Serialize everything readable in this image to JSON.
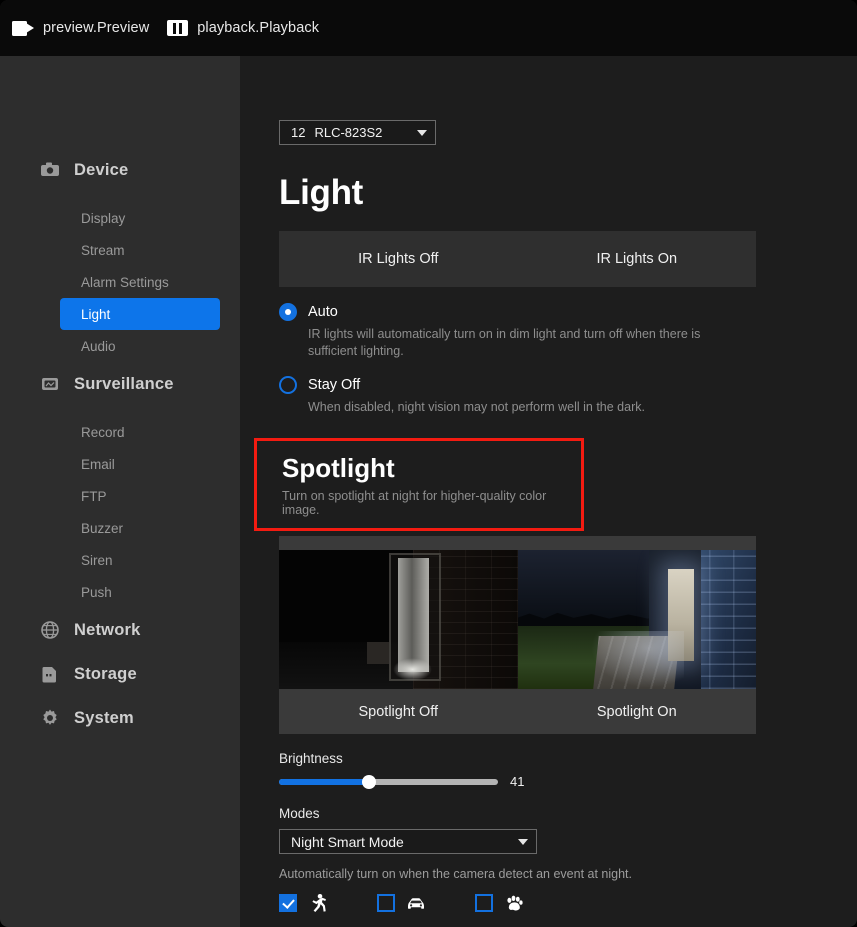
{
  "topbar": {
    "tabs": [
      {
        "icon": "video-camera-icon",
        "label": "preview.Preview"
      },
      {
        "icon": "film-strip-icon",
        "label": "playback.Playback"
      }
    ]
  },
  "sidebar": {
    "groups": [
      {
        "label": "Device",
        "icon": "camera-icon",
        "items": [
          {
            "label": "Display",
            "active": false
          },
          {
            "label": "Stream",
            "active": false
          },
          {
            "label": "Alarm Settings",
            "active": false
          },
          {
            "label": "Light",
            "active": true
          },
          {
            "label": "Audio",
            "active": false
          }
        ]
      },
      {
        "label": "Surveillance",
        "icon": "monitor-icon",
        "items": [
          {
            "label": "Record",
            "active": false
          },
          {
            "label": "Email",
            "active": false
          },
          {
            "label": "FTP",
            "active": false
          },
          {
            "label": "Buzzer",
            "active": false
          },
          {
            "label": "Siren",
            "active": false
          },
          {
            "label": "Push",
            "active": false
          }
        ]
      },
      {
        "label": "Network",
        "icon": "globe-icon",
        "items": []
      },
      {
        "label": "Storage",
        "icon": "sd-card-icon",
        "items": []
      },
      {
        "label": "System",
        "icon": "gear-icon",
        "items": []
      }
    ]
  },
  "main": {
    "camera_select": {
      "channel": "12",
      "model": "RLC-823S2",
      "icon": "chevron-down-icon"
    },
    "page_title": "Light",
    "ir": {
      "compare_left": "IR Lights Off",
      "compare_right": "IR Lights On",
      "options": [
        {
          "label": "Auto",
          "selected": true,
          "description": "IR lights will automatically turn on in dim light and turn off when there is sufficient lighting."
        },
        {
          "label": "Stay Off",
          "selected": false,
          "description": "When disabled, night vision may not perform well in the dark."
        }
      ]
    },
    "spotlight": {
      "title": "Spotlight",
      "description": "Turn on spotlight at night for higher-quality color image.",
      "highlight_color": "#f31b11",
      "compare_left": "Spotlight Off",
      "compare_right": "Spotlight On",
      "brightness_label": "Brightness",
      "brightness_value": "41",
      "brightness_percent": 41,
      "modes_label": "Modes",
      "mode_selected": "Night Smart Mode",
      "mode_icon": "chevron-down-icon",
      "detect_description": "Automatically turn on when the camera detect an event at night.",
      "detect_options": [
        {
          "name": "person",
          "icon": "person-running-icon",
          "checked": true
        },
        {
          "name": "vehicle",
          "icon": "car-icon",
          "checked": false
        },
        {
          "name": "pet",
          "icon": "paw-print-icon",
          "checked": false
        }
      ]
    }
  },
  "colors": {
    "accent": "#1371e0",
    "highlight": "#f31b11",
    "sidebar_bg": "#2d2d2d",
    "main_bg": "#1d1d1d",
    "topbar_bg": "#0a0a0a"
  }
}
